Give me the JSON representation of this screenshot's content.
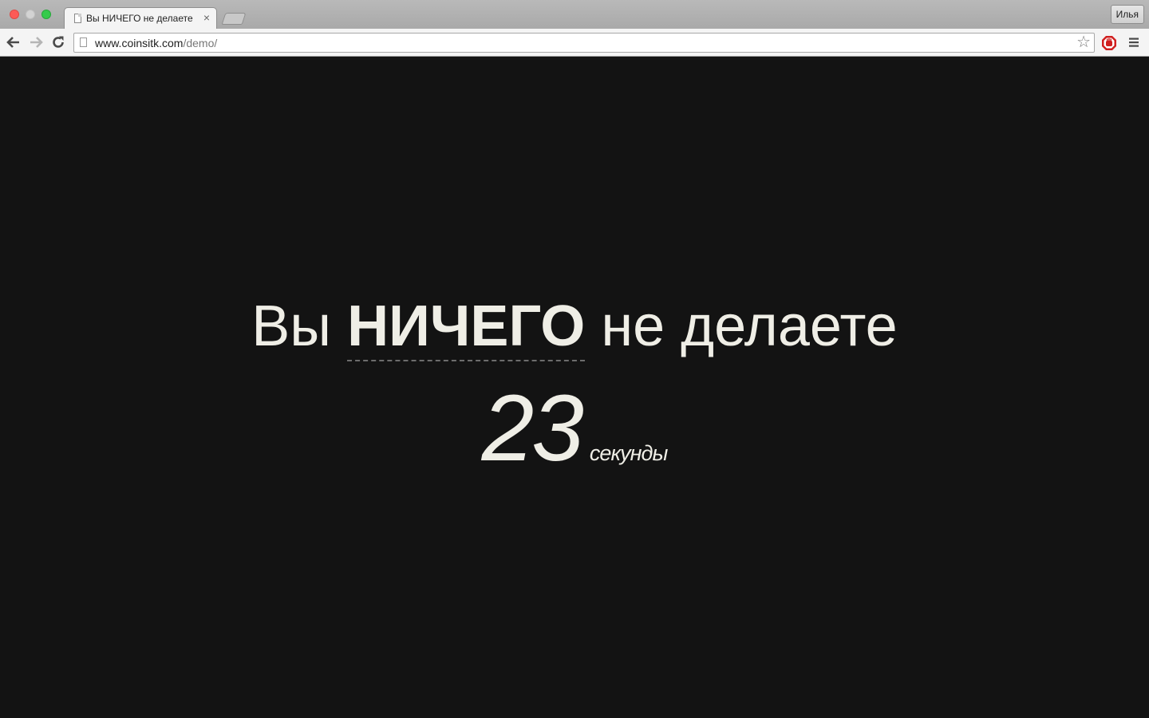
{
  "browser": {
    "tab": {
      "title": "Вы НИЧЕГО не делаете",
      "close_glyph": "×"
    },
    "profile_name": "Илья",
    "url": {
      "host": "www.coinsitk.com",
      "path": "/demo/"
    },
    "star_glyph": "☆",
    "traffic_lights": {
      "close_color": "#fc5b57",
      "minimize_color": "#d3d3d3",
      "maximize_color": "#35cb4b"
    },
    "extension_icon": "adblock-stop-icon",
    "extension_color": "#d01f1f"
  },
  "page": {
    "headline_prefix": "Вы",
    "headline_emphasis": "НИЧЕГО",
    "headline_suffix": "не делаете",
    "counter_value": "23",
    "counter_unit": "секунды",
    "background_color": "#131313",
    "text_color": "#efeee6"
  }
}
